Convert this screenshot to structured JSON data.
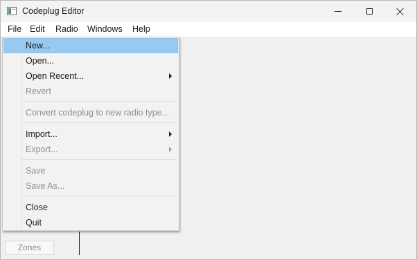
{
  "window": {
    "title": "Codeplug Editor"
  },
  "menubar": {
    "items": [
      "File",
      "Edit",
      "Radio",
      "Windows",
      "Help"
    ]
  },
  "file_menu": {
    "new": "New...",
    "open": "Open...",
    "open_recent": "Open Recent...",
    "revert": "Revert",
    "convert": "Convert codeplug to new radio type...",
    "import": "Import...",
    "export": "Export...",
    "save": "Save",
    "save_as": "Save As...",
    "close": "Close",
    "quit": "Quit"
  },
  "content": {
    "zones_button": "Zones"
  },
  "colors": {
    "highlight": "#99c9ef",
    "disabled_text": "#8f8f8f"
  }
}
